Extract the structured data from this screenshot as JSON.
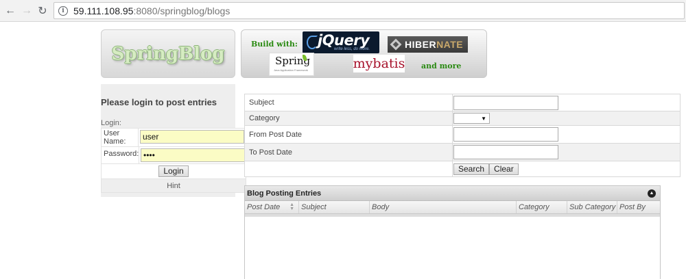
{
  "browser": {
    "url_host": "59.111.108.95",
    "url_rest": ":8080/springblog/blogs"
  },
  "logo": {
    "text": "SpringBlog"
  },
  "banner": {
    "built_with_label": "Build with:",
    "and_more_label": "and more",
    "jquery_text": "jQuery",
    "jquery_tagline": "write less, do more.",
    "hibernate_text_a": "HIBER",
    "hibernate_text_b": "NATE",
    "spring_text": "Spring",
    "spring_sub": "Java Application Framework",
    "mybatis_text": "mybatis"
  },
  "login": {
    "title": "Please login to post entries",
    "section_label": "Login:",
    "username_label": "User Name:",
    "username_value": "user",
    "password_label": "Password:",
    "password_value": "user",
    "login_button": "Login",
    "hint": "Hint"
  },
  "search": {
    "subject_label": "Subject",
    "category_label": "Category",
    "from_date_label": "From Post Date",
    "to_date_label": "To Post Date",
    "search_button": "Search",
    "clear_button": "Clear"
  },
  "grid": {
    "title": "Blog Posting Entries",
    "columns": [
      "Post Date",
      "Subject",
      "Body",
      "Category",
      "Sub Category",
      "Post By"
    ]
  }
}
